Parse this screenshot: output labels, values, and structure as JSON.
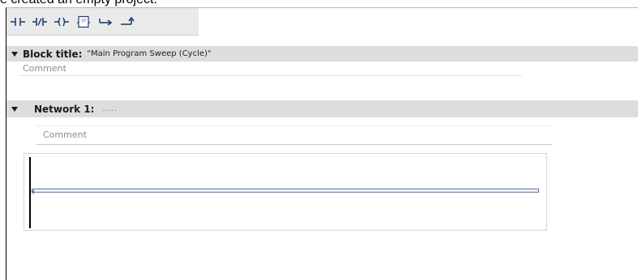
{
  "caption": "e created an empty project.",
  "toolbar": {
    "buttons": [
      {
        "name": "normally-open-contact-icon"
      },
      {
        "name": "normally-closed-contact-icon"
      },
      {
        "name": "output-coil-icon"
      },
      {
        "name": "empty-box-icon",
        "text": "??"
      },
      {
        "name": "open-branch-icon"
      },
      {
        "name": "close-branch-icon"
      }
    ]
  },
  "block": {
    "label": "Block title:",
    "value": "\"Main Program Sweep (Cycle)\"",
    "comment": "Comment"
  },
  "network": {
    "label": "Network 1:",
    "value": ".....",
    "comment": "Comment"
  }
}
